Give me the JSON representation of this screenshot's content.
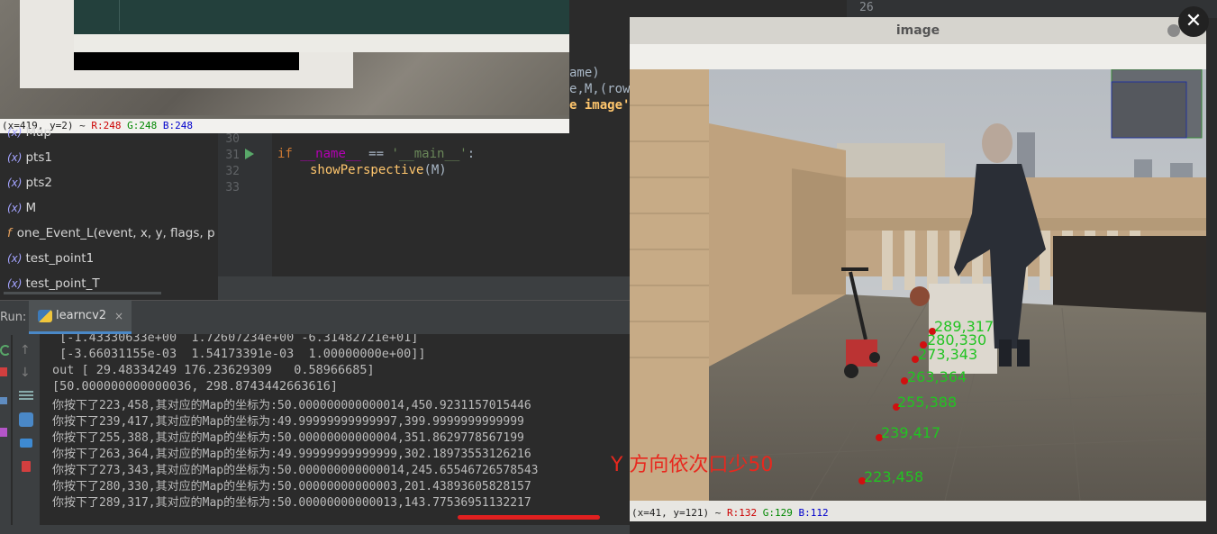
{
  "top_image_window": {
    "status_coords": "(x=419, y=2) ~",
    "status_r": "R:248",
    "status_g": "G:248",
    "status_b": "B:248"
  },
  "structure": {
    "items": [
      {
        "icon": "(x)",
        "label": "Map"
      },
      {
        "icon": "(x)",
        "label": "pts1"
      },
      {
        "icon": "(x)",
        "label": "pts2"
      },
      {
        "icon": "(x)",
        "label": "M"
      },
      {
        "icon": "f",
        "label": "one_Event_L(event, x, y, flags, p"
      },
      {
        "icon": "(x)",
        "label": "test_point1"
      },
      {
        "icon": "(x)",
        "label": "test_point_T"
      }
    ]
  },
  "editor": {
    "line_numbers": [
      "30",
      "31",
      "32",
      "33"
    ],
    "partial_lines": [
      "ame)",
      "e,M,(row",
      "e image'"
    ],
    "code_line_31_kw": "if",
    "code_line_31_name": "__name__",
    "code_line_31_op": " == ",
    "code_line_31_str": "'__main__'",
    "code_line_31_end": ":",
    "code_line_32_fn": "showPerspective",
    "code_line_32_args": "(M)"
  },
  "run_panel": {
    "label": "Run:",
    "tab_label": "learncv2",
    "tab_close": "×",
    "console_lines": [
      " [-1.43330633e+00  1.72607234e+00 -6.31482721e+01]",
      " [-3.66031155e-03  1.54173391e-03  1.00000000e+00]]",
      "out [ 29.48334249 176.23629309   0.58966685]",
      "[50.000000000000036, 298.8743442663616]",
      "你按下了223,458,其对应的Map的坐标为:50.000000000000014,450.9231157015446",
      "你按下了239,417,其对应的Map的坐标为:49.99999999999997,399.9999999999999",
      "你按下了255,388,其对应的Map的坐标为:50.00000000000004,351.8629778567199",
      "你按下了263,364,其对应的Map的坐标为:49.99999999999999,302.18973553126216",
      "你按下了273,343,其对应的Map的坐标为:50.000000000000014,245.65546726578543",
      "你按下了280,330,其对应的Map的坐标为:50.00000000000003,201.43893605828157",
      "你按下了289,317,其对应的Map的坐标为:50.00000000000013,143.77536951132217"
    ]
  },
  "right_editor": {
    "line_number": "26"
  },
  "image_window": {
    "title": "image",
    "close_glyph": "✕",
    "status_coords": "(x=41, y=121) ~",
    "status_r": "R:132",
    "status_g": "G:129",
    "status_b": "B:112",
    "points": [
      "289,317",
      "280,330",
      "273,343",
      "263,364",
      "255,388",
      "239,417",
      "223,458"
    ]
  },
  "annotation": "Y 方向依次口少50",
  "colors": {
    "annotation_red": "#e8281e",
    "point_green": "#22c322",
    "point_red": "#d01010",
    "ide_background": "#2b2b2b"
  }
}
